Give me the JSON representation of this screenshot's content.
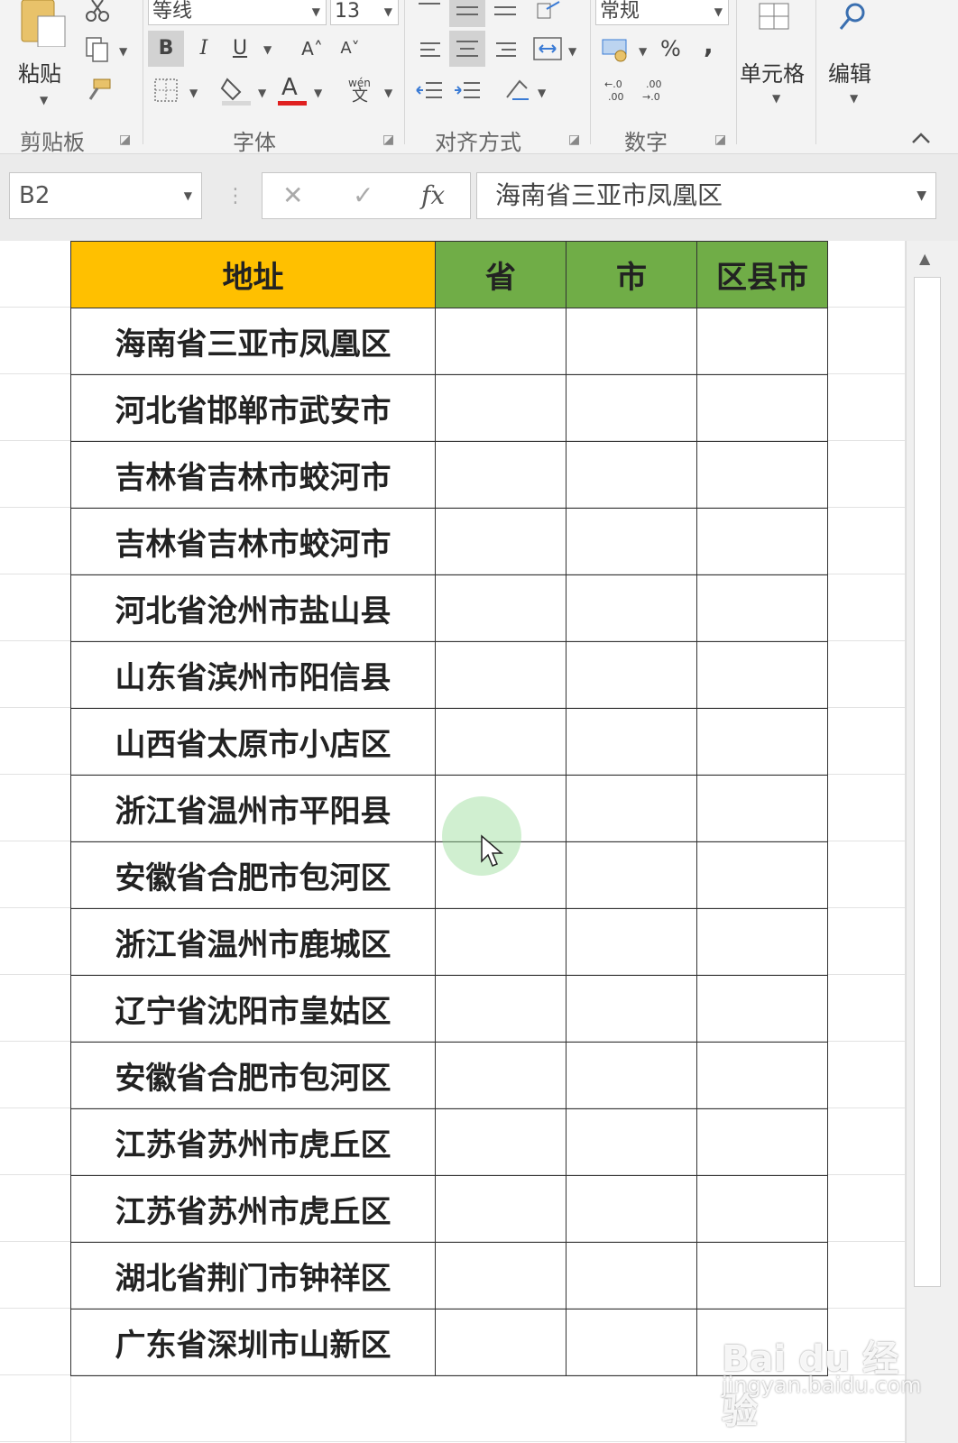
{
  "ribbon": {
    "clipboard": {
      "paste_label": "粘贴",
      "group_label": "剪贴板",
      "cut_icon": "scissors-icon",
      "copy_icon": "copy-icon",
      "format_painter_icon": "format-painter-icon"
    },
    "font": {
      "name": "等线",
      "size": "13",
      "bold": "B",
      "italic": "I",
      "underline": "U",
      "grow": "A˄",
      "shrink": "A˅",
      "font_color_glyph": "A",
      "phonetic_top": "wén",
      "phonetic_bottom": "文",
      "group_label": "字体",
      "font_color": "#e02020"
    },
    "alignment": {
      "group_label": "对齐方式"
    },
    "number": {
      "format": "常规",
      "percent": "%",
      "comma": ",",
      "inc_decimal_top": "←.0",
      "inc_decimal_bottom": ".00",
      "dec_decimal_top": ".00",
      "dec_decimal_bottom": "→.0",
      "group_label": "数字"
    },
    "cells_label": "单元格",
    "editing_label": "编辑"
  },
  "formula_bar": {
    "name_box": "B2",
    "cancel": "✕",
    "enter": "✓",
    "fx": "fx",
    "content": "海南省三亚市凤凰区"
  },
  "table": {
    "headers": [
      "地址",
      "省",
      "市",
      "区县市"
    ],
    "rows": [
      "海南省三亚市凤凰区",
      "河北省邯郸市武安市",
      "吉林省吉林市蛟河市",
      "吉林省吉林市蛟河市",
      "河北省沧州市盐山县",
      "山东省滨州市阳信县",
      "山西省太原市小店区",
      "浙江省温州市平阳县",
      "安徽省合肥市包河区",
      "浙江省温州市鹿城区",
      "辽宁省沈阳市皇姑区",
      "安徽省合肥市包河区",
      "江苏省苏州市虎丘区",
      "江苏省苏州市虎丘区",
      "湖北省荆门市钟祥区",
      "广东省深圳市山新区"
    ],
    "header_colors": {
      "address": "#ffc000",
      "split": "#70ad47"
    }
  },
  "watermark": {
    "brand": "Bai du 经验",
    "url": "jingyan.baidu.com"
  }
}
